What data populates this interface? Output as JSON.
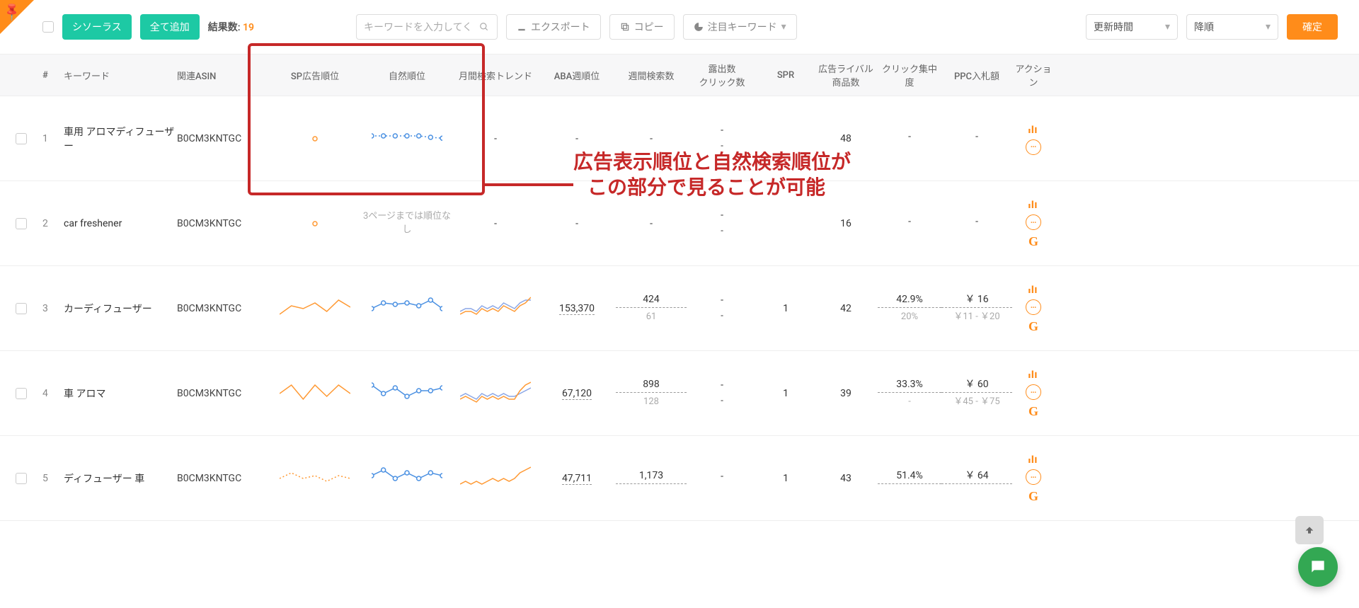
{
  "toolbar": {
    "thesaurus_label": "シソーラス",
    "add_all_label": "全て追加",
    "results_label": "結果数:",
    "results_count": "19",
    "search_placeholder": "キーワードを入力してく",
    "export_label": "エクスポート",
    "copy_label": "コピー",
    "featured_label": "注目キーワード",
    "sort_field_label": "更新時間",
    "sort_order_label": "降順",
    "confirm_label": "確定"
  },
  "headers": {
    "num": "#",
    "keyword": "キーワード",
    "asin": "関連ASIN",
    "sp_rank": "SP広告順位",
    "natural_rank": "自然順位",
    "trend": "月間検索トレンド",
    "aba": "ABA週順位",
    "weekly": "週間検索数",
    "exposure": "露出数\nクリック数",
    "spr": "SPR",
    "rivals": "広告ライバル商品数",
    "click_concentration": "クリック集中度",
    "ppc": "PPC入札額",
    "action": "アクション"
  },
  "annotation": {
    "line1": "広告表示順位と自然検索順位が",
    "line2": "この部分で見ることが可能"
  },
  "rows": [
    {
      "num": "1",
      "keyword": "車用 アロマディフューザー",
      "asin": "B0CM3KNTGC",
      "natural_text": null,
      "trend": "-",
      "aba": "-",
      "weekly": "-",
      "exposure1": "-",
      "exposure2": "-",
      "spr": "",
      "rivals": "48",
      "click_main": "-",
      "click_sub": "",
      "ppc_main": "-",
      "ppc_sub": "",
      "show_g": false
    },
    {
      "num": "2",
      "keyword": "car freshener",
      "asin": "B0CM3KNTGC",
      "natural_text": "3ページまでは順位なし",
      "trend": "-",
      "aba": "-",
      "weekly": "-",
      "exposure1": "-",
      "exposure2": "-",
      "spr": "",
      "rivals": "16",
      "click_main": "-",
      "click_sub": "",
      "ppc_main": "-",
      "ppc_sub": "",
      "show_g": true
    },
    {
      "num": "3",
      "keyword": "カーディフューザー",
      "asin": "B0CM3KNTGC",
      "natural_text": null,
      "trend": "chart",
      "aba": "153,370",
      "weekly_main": "424",
      "weekly_sub": "61",
      "exposure1": "-",
      "exposure2": "-",
      "spr": "1",
      "rivals": "42",
      "click_main": "42.9%",
      "click_sub": "20%",
      "ppc_main": "￥ 16",
      "ppc_sub": "￥11 - ￥20",
      "show_g": true
    },
    {
      "num": "4",
      "keyword": "車 アロマ",
      "asin": "B0CM3KNTGC",
      "natural_text": null,
      "trend": "chart",
      "aba": "67,120",
      "weekly_main": "898",
      "weekly_sub": "128",
      "exposure1": "-",
      "exposure2": "-",
      "spr": "1",
      "rivals": "39",
      "click_main": "33.3%",
      "click_sub": "-",
      "ppc_main": "￥ 60",
      "ppc_sub": "￥45 - ￥75",
      "show_g": true
    },
    {
      "num": "5",
      "keyword": "ディフューザー 車",
      "asin": "B0CM3KNTGC",
      "natural_text": null,
      "trend": "chart",
      "aba": "47,711",
      "weekly_main": "1,173",
      "weekly_sub": "",
      "exposure1": "-",
      "exposure2": "",
      "spr": "1",
      "rivals": "43",
      "click_main": "51.4%",
      "click_sub": "",
      "ppc_main": "￥ 64",
      "ppc_sub": "",
      "show_g": true
    }
  ],
  "chart_data": [
    {
      "row": 1,
      "col": "sp_rank",
      "type": "scatter",
      "x": [
        3
      ],
      "y": [
        5
      ],
      "color": "#ff9933"
    },
    {
      "row": 1,
      "col": "natural_rank",
      "type": "line",
      "x": [
        0,
        1,
        2,
        3,
        4,
        5,
        6
      ],
      "y": [
        6,
        6,
        6,
        6,
        6,
        5.5,
        5.2
      ],
      "style": "dotted",
      "markers": true,
      "color": "#4a90e2"
    },
    {
      "row": 2,
      "col": "sp_rank",
      "type": "scatter",
      "x": [
        3
      ],
      "y": [
        5
      ],
      "color": "#ff9933"
    },
    {
      "row": 3,
      "col": "sp_rank",
      "type": "line",
      "x": [
        0,
        1,
        2,
        3,
        4,
        5,
        6
      ],
      "y": [
        3,
        6,
        5,
        7,
        4,
        8,
        5.5
      ],
      "color": "#ff9933"
    },
    {
      "row": 3,
      "col": "natural_rank",
      "type": "line",
      "x": [
        0,
        1,
        2,
        3,
        4,
        5,
        6
      ],
      "y": [
        5,
        7,
        6.5,
        7,
        6,
        8,
        5
      ],
      "markers": true,
      "color": "#4a90e2"
    },
    {
      "row": 3,
      "col": "trend",
      "type": "line",
      "series": [
        {
          "color": "#8aa6e6",
          "values": [
            4,
            5,
            5,
            4,
            6,
            5,
            6,
            5,
            7,
            6,
            5,
            7,
            8,
            8
          ]
        },
        {
          "color": "#ff9933",
          "values": [
            3,
            4,
            4,
            3,
            5,
            4,
            5,
            4,
            6,
            5,
            4,
            6,
            7,
            9
          ]
        }
      ]
    },
    {
      "row": 4,
      "col": "sp_rank",
      "type": "line",
      "x": [
        0,
        1,
        2,
        3,
        4,
        5,
        6
      ],
      "y": [
        5,
        8,
        3,
        8,
        4,
        8,
        5
      ],
      "color": "#ff9933"
    },
    {
      "row": 4,
      "col": "natural_rank",
      "type": "line",
      "x": [
        0,
        1,
        2,
        3,
        4,
        5,
        6
      ],
      "y": [
        8,
        5,
        7,
        4,
        6,
        6,
        7
      ],
      "style": "partial-dotted",
      "markers": true,
      "color": "#4a90e2"
    },
    {
      "row": 4,
      "col": "trend",
      "type": "line",
      "series": [
        {
          "color": "#8aa6e6",
          "values": [
            4,
            5,
            4,
            3,
            5,
            4,
            5,
            4,
            5,
            4,
            4,
            5,
            6,
            7
          ]
        },
        {
          "color": "#ff9933",
          "values": [
            3,
            4,
            3,
            2,
            4,
            3,
            4,
            3,
            4,
            3,
            3,
            6,
            8,
            9
          ]
        }
      ]
    },
    {
      "row": 5,
      "col": "sp_rank",
      "type": "line",
      "x": [
        0,
        1,
        2,
        3,
        4,
        5,
        6
      ],
      "y": [
        5,
        7,
        5,
        6,
        4,
        6,
        5
      ],
      "style": "dotted",
      "color": "#ff9933"
    },
    {
      "row": 5,
      "col": "natural_rank",
      "type": "line",
      "x": [
        0,
        1,
        2,
        3,
        4,
        5,
        6
      ],
      "y": [
        6,
        8,
        5,
        7,
        5,
        7,
        6
      ],
      "markers": true,
      "color": "#4a90e2"
    },
    {
      "row": 5,
      "col": "trend",
      "type": "line",
      "series": [
        {
          "color": "#ff9933",
          "values": [
            3,
            4,
            3,
            4,
            3,
            4,
            5,
            4,
            5,
            4,
            5,
            7,
            8,
            9
          ]
        }
      ]
    }
  ]
}
